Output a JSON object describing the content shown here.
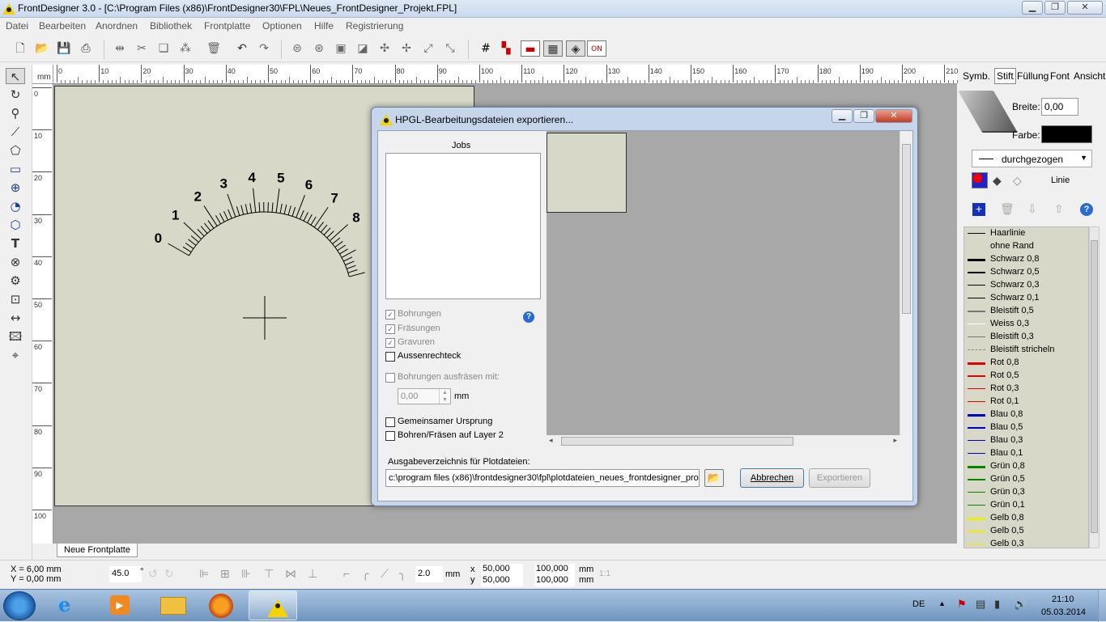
{
  "window": {
    "title": "FrontDesigner 3.0 - [C:\\Program Files (x86)\\FrontDesigner30\\FPL\\Neues_FrontDesigner_Projekt.FPL]"
  },
  "menu": [
    "Datei",
    "Bearbeiten",
    "Anordnen",
    "Bibliothek",
    "Frontplatte",
    "Optionen",
    "Hilfe",
    "Registrierung"
  ],
  "ruler": {
    "unit": "mm",
    "top": [
      "0",
      "10",
      "20",
      "30",
      "40",
      "50",
      "60",
      "70",
      "80",
      "90",
      "100",
      "110",
      "120",
      "130",
      "140",
      "150",
      "160",
      "170",
      "180",
      "190",
      "200",
      "210"
    ],
    "left": [
      "0",
      "10",
      "20",
      "30",
      "40",
      "50",
      "60",
      "70",
      "80",
      "90",
      "100"
    ]
  },
  "scale": [
    "0",
    "1",
    "2",
    "3",
    "4",
    "5",
    "6",
    "7",
    "8"
  ],
  "tab": {
    "label": "Neue Frontplatte"
  },
  "right": {
    "tabs": [
      "Symb.",
      "Stift",
      "Füllung",
      "Font",
      "Ansicht"
    ],
    "breite_label": "Breite:",
    "breite_value": "0,00",
    "farbe_label": "Farbe:",
    "linestyle": "durchgezogen",
    "linie_label": "Linie",
    "pens": [
      {
        "label": "Haarlinie",
        "color": "#000000",
        "w": 1
      },
      {
        "label": "ohne Rand",
        "color": "transparent",
        "w": 0
      },
      {
        "label": "Schwarz 0,8",
        "color": "#000000",
        "w": 3
      },
      {
        "label": "Schwarz 0,5",
        "color": "#000000",
        "w": 2
      },
      {
        "label": "Schwarz 0,3",
        "color": "#000000",
        "w": 1
      },
      {
        "label": "Schwarz 0,1",
        "color": "#000000",
        "w": 1
      },
      {
        "label": "Bleistift 0,5",
        "color": "#777777",
        "w": 2
      },
      {
        "label": "Weiss 0,3",
        "color": "#ffffff",
        "w": 1
      },
      {
        "label": "Bleistift 0,3",
        "color": "#777777",
        "w": 1
      },
      {
        "label": "Bleistift stricheln",
        "color": "#888888",
        "w": 1,
        "dash": true
      },
      {
        "label": "Rot 0,8",
        "color": "#e00000",
        "w": 3
      },
      {
        "label": "Rot 0,5",
        "color": "#e00000",
        "w": 2
      },
      {
        "label": "Rot 0,3",
        "color": "#e00000",
        "w": 1
      },
      {
        "label": "Rot 0,1",
        "color": "#e00000",
        "w": 1
      },
      {
        "label": "Blau 0,8",
        "color": "#0000cc",
        "w": 3
      },
      {
        "label": "Blau 0,5",
        "color": "#0000cc",
        "w": 2
      },
      {
        "label": "Blau 0,3",
        "color": "#0000cc",
        "w": 1
      },
      {
        "label": "Blau 0,1",
        "color": "#0000cc",
        "w": 1
      },
      {
        "label": "Grün 0,8",
        "color": "#008800",
        "w": 3
      },
      {
        "label": "Grün 0,5",
        "color": "#008800",
        "w": 2
      },
      {
        "label": "Grün 0,3",
        "color": "#008800",
        "w": 1
      },
      {
        "label": "Grün 0,1",
        "color": "#008800",
        "w": 1
      },
      {
        "label": "Gelb 0,8",
        "color": "#eeee00",
        "w": 3
      },
      {
        "label": "Gelb 0,5",
        "color": "#eeee00",
        "w": 2
      },
      {
        "label": "Gelb 0,3",
        "color": "#eeee00",
        "w": 1
      }
    ]
  },
  "dialog": {
    "title": "HPGL-Bearbeitungsdateien exportieren...",
    "jobs_label": "Jobs",
    "checks": [
      {
        "label": "Bohrungen",
        "checked": true,
        "enabled": false
      },
      {
        "label": "Fräsungen",
        "checked": true,
        "enabled": false
      },
      {
        "label": "Gravuren",
        "checked": true,
        "enabled": false
      },
      {
        "label": "Aussenrechteck",
        "checked": false,
        "enabled": true
      }
    ],
    "ausfraesen_label": "Bohrungen ausfräsen mit:",
    "ausfraesen_value": "0,00",
    "mm": "mm",
    "ursprung_label": "Gemeinsamer Ursprung",
    "layer2_label": "Bohren/Fräsen auf Layer 2",
    "output_label": "Ausgabeverzeichnis für Plotdateien:",
    "output_path": "c:\\program files (x86)\\frontdesigner30\\fpl\\plotdateien_neues_frontdesigner_pro",
    "cancel": "Abbrechen",
    "export": "Exportieren"
  },
  "status": {
    "x": "X = 6,00 mm",
    "y": "Y = 0,00 mm",
    "angle": "45.0",
    "deg": "°",
    "radius": "2.0",
    "radius_unit": "mm",
    "pos_x_label": "x",
    "pos_x": "50,000",
    "pos_y_label": "y",
    "pos_y": "50,000",
    "size_w": "100,000",
    "size_h": "100,000",
    "size_unit_w": "mm",
    "size_unit_h": "mm",
    "ratio": "1:1"
  },
  "taskbar": {
    "lang": "DE",
    "time": "21:10",
    "date": "05.03.2014"
  }
}
